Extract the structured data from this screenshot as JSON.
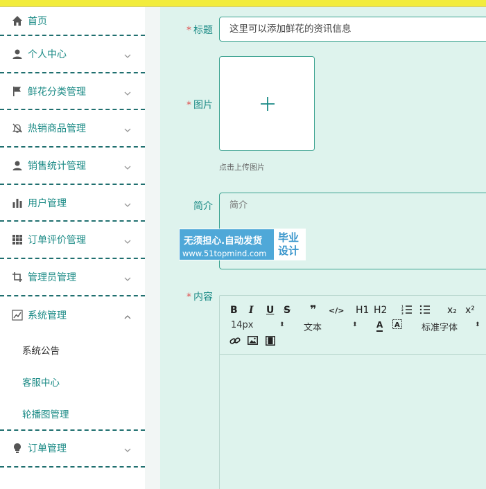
{
  "colors": {
    "accent": "#1a8a85",
    "topbar": "#f2ec3c",
    "main_bg": "#def3ed",
    "border": "#39a18f",
    "required": "#e05050"
  },
  "sidebar": {
    "items": [
      {
        "label": "首页",
        "icon": "home-icon"
      },
      {
        "label": "个人中心",
        "icon": "user-icon"
      },
      {
        "label": "鲜花分类管理",
        "icon": "flag-icon"
      },
      {
        "label": "热销商品管理",
        "icon": "bell-off-icon"
      },
      {
        "label": "销售统计管理",
        "icon": "user-icon"
      },
      {
        "label": "用户管理",
        "icon": "bar-chart-icon"
      },
      {
        "label": "订单评价管理",
        "icon": "grid-icon"
      },
      {
        "label": "管理员管理",
        "icon": "crop-icon"
      },
      {
        "label": "系统管理",
        "icon": "line-chart-icon"
      },
      {
        "label": "订单管理",
        "icon": "bulb-icon"
      }
    ],
    "submenu": [
      "系统公告",
      "客服中心",
      "轮播图管理"
    ]
  },
  "form": {
    "title_label": "标题",
    "title_value": "这里可以添加鲜花的资讯信息",
    "image_label": "图片",
    "upload_tip": "点击上传图片",
    "intro_label": "简介",
    "intro_placeholder": "简介",
    "content_label": "内容",
    "required_mark": "*"
  },
  "editor": {
    "font_size": "14px",
    "paragraph": "文本",
    "font_family": "标准字体",
    "buttons": [
      "B",
      "I",
      "U",
      "S",
      "❞",
      "</>",
      "H1",
      "H2",
      "ordered-list",
      "bullet-list",
      "x₂",
      "x²",
      "A",
      "A-bg",
      "link",
      "image",
      "video"
    ]
  },
  "watermark": {
    "line1": "无须担心.自动发货",
    "line2": "www.51topmind.com",
    "right1": "毕业",
    "right2": "设计"
  }
}
